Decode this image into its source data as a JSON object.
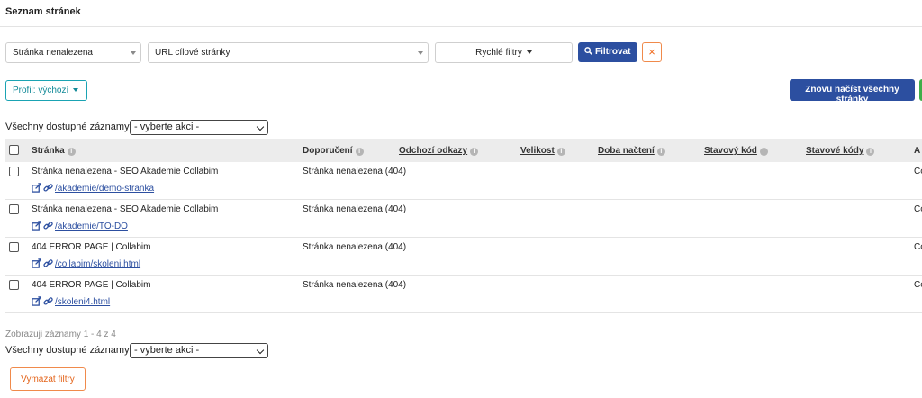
{
  "page": {
    "title": "Seznam stránek"
  },
  "filters": {
    "status_select": "Stránka nenalezena",
    "url_select": "URL cílové stránky",
    "quick_filters": "Rychlé filtry",
    "filter_button": "Filtrovat",
    "clear_icon": "×"
  },
  "profile": {
    "label": "Profil: výchozí"
  },
  "reload_button": "Znovu načíst všechny stránky",
  "bulk": {
    "label": "Všechny dostupné záznamy",
    "action": "- vyberte akci -"
  },
  "table": {
    "columns": [
      "Stránka",
      "Doporučení",
      "Odchozí odkazy",
      "Velikost",
      "Doba načtení",
      "Stavový kód",
      "Stavové kódy",
      "A"
    ],
    "rows": [
      {
        "title": "Stránka nenalezena - SEO Akademie Collabim",
        "url": "/akademie/demo-stranka",
        "recommendation": "Stránka nenalezena (404)",
        "cut": "Co"
      },
      {
        "title": "Stránka nenalezena - SEO Akademie Collabim",
        "url": "/akademie/TO-DO",
        "recommendation": "Stránka nenalezena (404)",
        "cut": "Co"
      },
      {
        "title": "404 ERROR PAGE | Collabim",
        "url": "/collabim/skoleni.html",
        "recommendation": "Stránka nenalezena (404)",
        "cut": "Co"
      },
      {
        "title": "404 ERROR PAGE | Collabim",
        "url": "/skoleni4.html",
        "recommendation": "Stránka nenalezena (404)",
        "cut": "Co"
      }
    ]
  },
  "summary": "Zobrazuji záznamy 1 - 4 z 4",
  "reset_button": "Vymazat filtry",
  "colors": {
    "primary": "#2c4fa0",
    "teal": "#1aa3b3",
    "orange": "#f06a1e",
    "green": "#3fae49"
  },
  "icons": {
    "search": "search-icon",
    "clear": "close-icon",
    "edit": "external-edit-icon",
    "link": "link-icon",
    "info": "info-icon"
  }
}
